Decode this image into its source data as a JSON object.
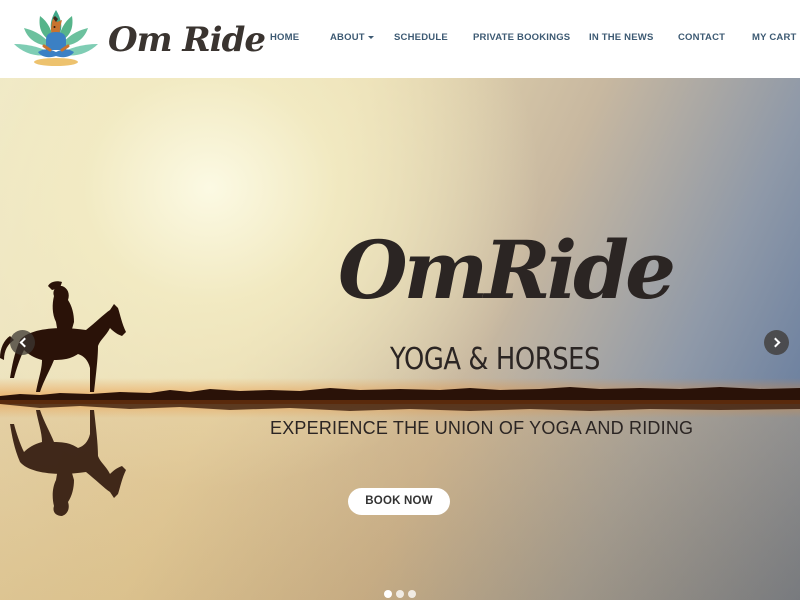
{
  "brand": {
    "logo_text": "Om Ride",
    "logo_icon": "lotus-horse-logo-icon"
  },
  "nav": {
    "items": [
      {
        "label": "HOME"
      },
      {
        "label": "ABOUT",
        "has_dropdown": true
      },
      {
        "label": "SCHEDULE"
      },
      {
        "label": "PRIVATE BOOKINGS"
      },
      {
        "label": "IN THE NEWS"
      },
      {
        "label": "CONTACT"
      },
      {
        "label": "MY CART"
      }
    ]
  },
  "hero": {
    "title": "OmRide",
    "subtitle": "YOGA & HORSES",
    "tagline": "EXPERIENCE THE UNION OF YOGA AND RIDING",
    "cta_label": "BOOK NOW",
    "prev_icon": "chevron-left-icon",
    "next_icon": "chevron-right-icon",
    "slides_total": 3,
    "active_slide": 1
  },
  "colors": {
    "nav_text": "#3d5a73",
    "logo_text": "#3a3430",
    "hero_text": "#2b2523",
    "sky_light": "#efe8c8",
    "sky_blue": "#55709a",
    "silhouette": "#2a1208",
    "horizon_glow": "#e8892a"
  }
}
